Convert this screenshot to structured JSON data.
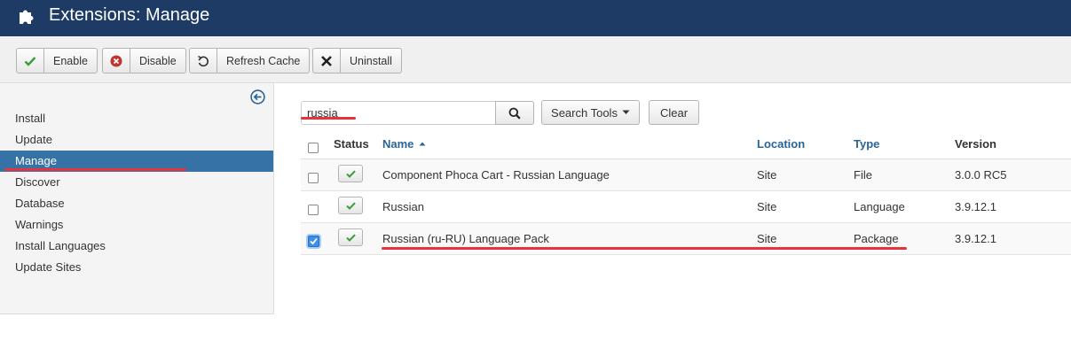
{
  "header": {
    "title": "Extensions: Manage"
  },
  "toolbar": {
    "enable_label": "Enable",
    "disable_label": "Disable",
    "refresh_label": "Refresh Cache",
    "uninstall_label": "Uninstall"
  },
  "sidebar": {
    "items": [
      {
        "label": "Install"
      },
      {
        "label": "Update"
      },
      {
        "label": "Manage"
      },
      {
        "label": "Discover"
      },
      {
        "label": "Database"
      },
      {
        "label": "Warnings"
      },
      {
        "label": "Install Languages"
      },
      {
        "label": "Update Sites"
      }
    ],
    "active_item": "Manage"
  },
  "search": {
    "value": "russia",
    "search_tools_label": "Search Tools",
    "clear_label": "Clear"
  },
  "table": {
    "columns": {
      "status": "Status",
      "name": "Name",
      "location": "Location",
      "type": "Type",
      "version": "Version"
    },
    "rows": [
      {
        "name": "Component Phoca Cart - Russian Language",
        "location": "Site",
        "type": "File",
        "version": "3.0.0 RC5",
        "checked": false
      },
      {
        "name": "Russian",
        "location": "Site",
        "type": "Language",
        "version": "3.9.12.1",
        "checked": false
      },
      {
        "name": "Russian (ru-RU) Language Pack",
        "location": "Site",
        "type": "Package",
        "version": "3.9.12.1",
        "checked": true
      }
    ]
  },
  "colors": {
    "header_bg": "#1d3b64",
    "active_nav": "#3672a6",
    "link": "#2a6496",
    "annotation_red": "#e8333b",
    "enabled_green": "#3a9d3a"
  }
}
